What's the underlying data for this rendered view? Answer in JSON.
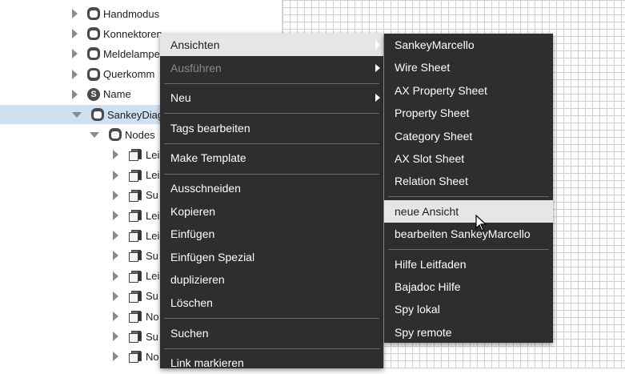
{
  "tree": {
    "rows": [
      {
        "label": "Handmodus",
        "icon": "component-icon",
        "expander": "collapsed"
      },
      {
        "label": "Konnektoren",
        "icon": "component-icon",
        "expander": "collapsed"
      },
      {
        "label": "Meldelampen",
        "icon": "component-icon",
        "expander": "collapsed"
      },
      {
        "label": "Querkomm",
        "icon": "component-icon",
        "expander": "collapsed"
      },
      {
        "label": "Name",
        "icon": "string-slot-icon",
        "expander": "collapsed"
      },
      {
        "label": "SankeyDiagr",
        "icon": "component-icon",
        "expander": "expanded",
        "selected": true
      },
      {
        "label": "Nodes",
        "icon": "component-icon",
        "expander": "expanded"
      },
      {
        "label": "Lei",
        "icon": "cube-icon",
        "expander": "collapsed"
      },
      {
        "label": "Lei",
        "icon": "cube-icon",
        "expander": "collapsed"
      },
      {
        "label": "Su",
        "icon": "cube-icon",
        "expander": "collapsed"
      },
      {
        "label": "Lei",
        "icon": "cube-icon",
        "expander": "collapsed"
      },
      {
        "label": "Lei",
        "icon": "cube-icon",
        "expander": "collapsed"
      },
      {
        "label": "Su",
        "icon": "cube-icon",
        "expander": "collapsed"
      },
      {
        "label": "Lei",
        "icon": "cube-icon",
        "expander": "collapsed"
      },
      {
        "label": "Su",
        "icon": "cube-icon",
        "expander": "collapsed"
      },
      {
        "label": "No",
        "icon": "cube-icon",
        "expander": "collapsed"
      },
      {
        "label": "Su",
        "icon": "cube-icon",
        "expander": "collapsed"
      },
      {
        "label": "No",
        "icon": "cube-icon",
        "expander": "collapsed"
      }
    ]
  },
  "context_menu": {
    "items": [
      {
        "label": "Ansichten",
        "submenu": true,
        "highlighted": true
      },
      {
        "label": "Ausführen",
        "submenu": true,
        "disabled": true
      },
      {
        "separator": true
      },
      {
        "label": "Neu",
        "submenu": true
      },
      {
        "separator": true
      },
      {
        "label": "Tags bearbeiten"
      },
      {
        "separator": true
      },
      {
        "label": "Make Template"
      },
      {
        "separator": true
      },
      {
        "label": "Ausschneiden"
      },
      {
        "label": "Kopieren"
      },
      {
        "label": "Einfügen"
      },
      {
        "label": "Einfügen Spezial"
      },
      {
        "label": "duplizieren"
      },
      {
        "label": "Löschen"
      },
      {
        "separator": true
      },
      {
        "label": "Suchen"
      },
      {
        "separator": true
      },
      {
        "label": "Link markieren"
      }
    ]
  },
  "submenu": {
    "items": [
      {
        "label": "SankeyMarcello"
      },
      {
        "label": "Wire Sheet"
      },
      {
        "label": "AX Property Sheet"
      },
      {
        "label": "Property Sheet"
      },
      {
        "label": "Category Sheet"
      },
      {
        "label": "AX Slot Sheet"
      },
      {
        "label": "Relation Sheet"
      },
      {
        "separator": true
      },
      {
        "label": "neue Ansicht",
        "highlighted": true
      },
      {
        "label": "bearbeiten SankeyMarcello"
      },
      {
        "separator": true
      },
      {
        "label": "Hilfe Leitfaden"
      },
      {
        "label": "Bajadoc Hilfe"
      },
      {
        "label": "Spy lokal"
      },
      {
        "label": "Spy remote"
      }
    ]
  },
  "colors": {
    "menu_bg": "#2e2e2e",
    "menu_highlight": "#e6e6e6",
    "selection": "#cfe0f2"
  }
}
